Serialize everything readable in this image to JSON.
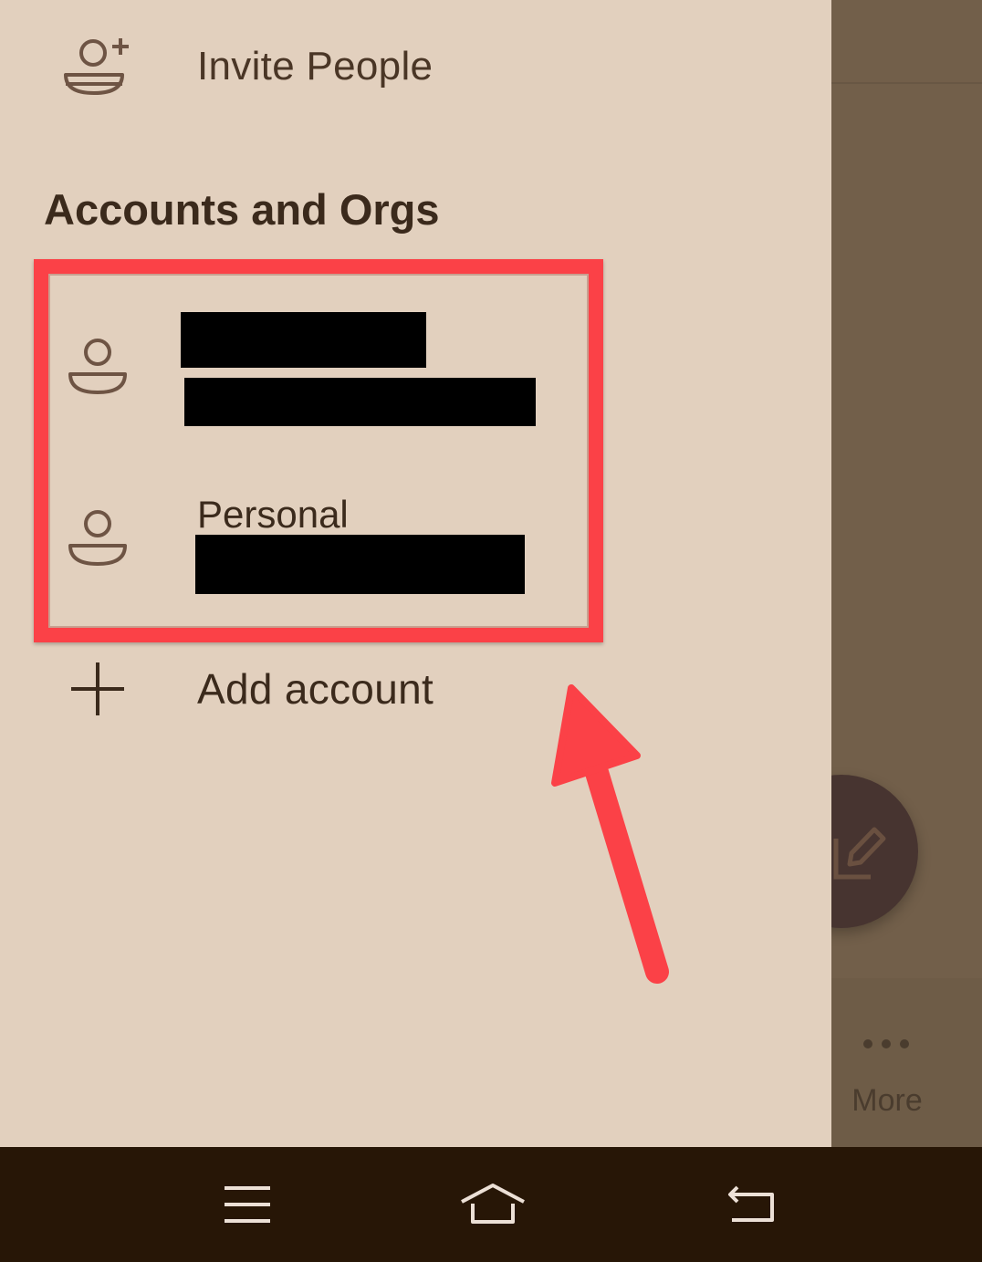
{
  "drawer": {
    "invite_label": "Invite People",
    "section_title": "Accounts and Orgs",
    "accounts": [
      {
        "name": "",
        "email": ""
      },
      {
        "name": "Personal",
        "email": ""
      }
    ],
    "add_account_label": "Add account"
  },
  "background_app": {
    "more_label": "More"
  },
  "colors": {
    "drawer_bg": "#e2d0be",
    "dim_bg": "#725f4a",
    "text": "#3b2a1c",
    "icon": "#6e5444",
    "highlight": "#fb4147",
    "fab": "#473430",
    "navbar": "#271606"
  },
  "icons": {
    "invite": "person-add-icon",
    "account": "person-icon",
    "add": "plus-icon",
    "fab": "compose-icon",
    "more": "more-dots-icon",
    "nav_menu": "menu-icon",
    "nav_home": "home-icon",
    "nav_back": "back-icon"
  }
}
